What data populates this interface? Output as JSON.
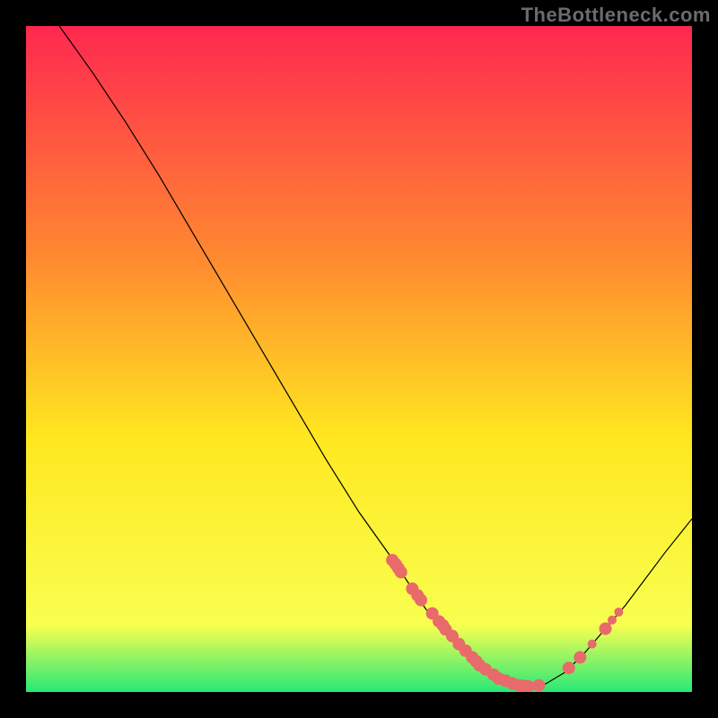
{
  "watermark": "TheBottleneck.com",
  "chart_data": {
    "type": "line",
    "title": "",
    "xlabel": "",
    "ylabel": "",
    "xlim": [
      0,
      100
    ],
    "ylim": [
      0,
      100
    ],
    "background_gradient": {
      "top": "#ff2850",
      "mid1": "#ff8a30",
      "mid2": "#ffe820",
      "bottom_mid": "#f8ff50",
      "bottom": "#28e878"
    },
    "series": [
      {
        "name": "curve",
        "type": "line",
        "color": "#000000",
        "width": 1.2,
        "x": [
          5,
          10,
          15,
          20,
          25,
          30,
          35,
          40,
          45,
          50,
          55,
          58,
          60,
          63,
          66,
          69,
          72,
          74,
          76,
          78,
          81,
          84,
          87,
          90,
          93,
          96,
          100
        ],
        "y": [
          100,
          93,
          85.5,
          77.5,
          69,
          60.5,
          52,
          43.5,
          35,
          27,
          20,
          15.5,
          12.5,
          9,
          6,
          3.5,
          1.8,
          1.0,
          0.8,
          1.2,
          3,
          6,
          9.5,
          13,
          17,
          21,
          26
        ]
      },
      {
        "name": "markers",
        "type": "scatter",
        "color": "#e86a6a",
        "x": [
          55.0,
          55.5,
          55.9,
          56.3,
          58.0,
          58.8,
          59.3,
          61.0,
          62.0,
          62.6,
          63.0,
          64.0,
          65.0,
          66.0,
          67.0,
          67.6,
          68.1,
          69.0,
          70.2,
          71.0,
          72.0,
          73.0,
          74.0,
          74.7,
          75.4,
          77.0,
          81.5,
          83.2,
          85.0,
          87.0,
          88.0,
          89.0
        ],
        "y": [
          19.8,
          19.2,
          18.6,
          18.0,
          15.5,
          14.5,
          13.8,
          11.8,
          10.6,
          10.0,
          9.4,
          8.4,
          7.2,
          6.2,
          5.2,
          4.6,
          4.0,
          3.4,
          2.6,
          2.0,
          1.7,
          1.3,
          1.0,
          0.9,
          0.85,
          1.0,
          3.6,
          5.2,
          7.2,
          9.5,
          10.8,
          12.0
        ],
        "r": [
          7,
          7,
          7,
          7,
          7,
          7,
          7,
          7,
          7,
          7,
          7,
          7,
          7,
          7,
          7,
          7,
          7,
          7,
          7,
          7,
          7,
          7,
          7,
          7,
          7,
          7,
          7,
          7,
          5,
          7,
          5,
          5
        ]
      }
    ]
  }
}
